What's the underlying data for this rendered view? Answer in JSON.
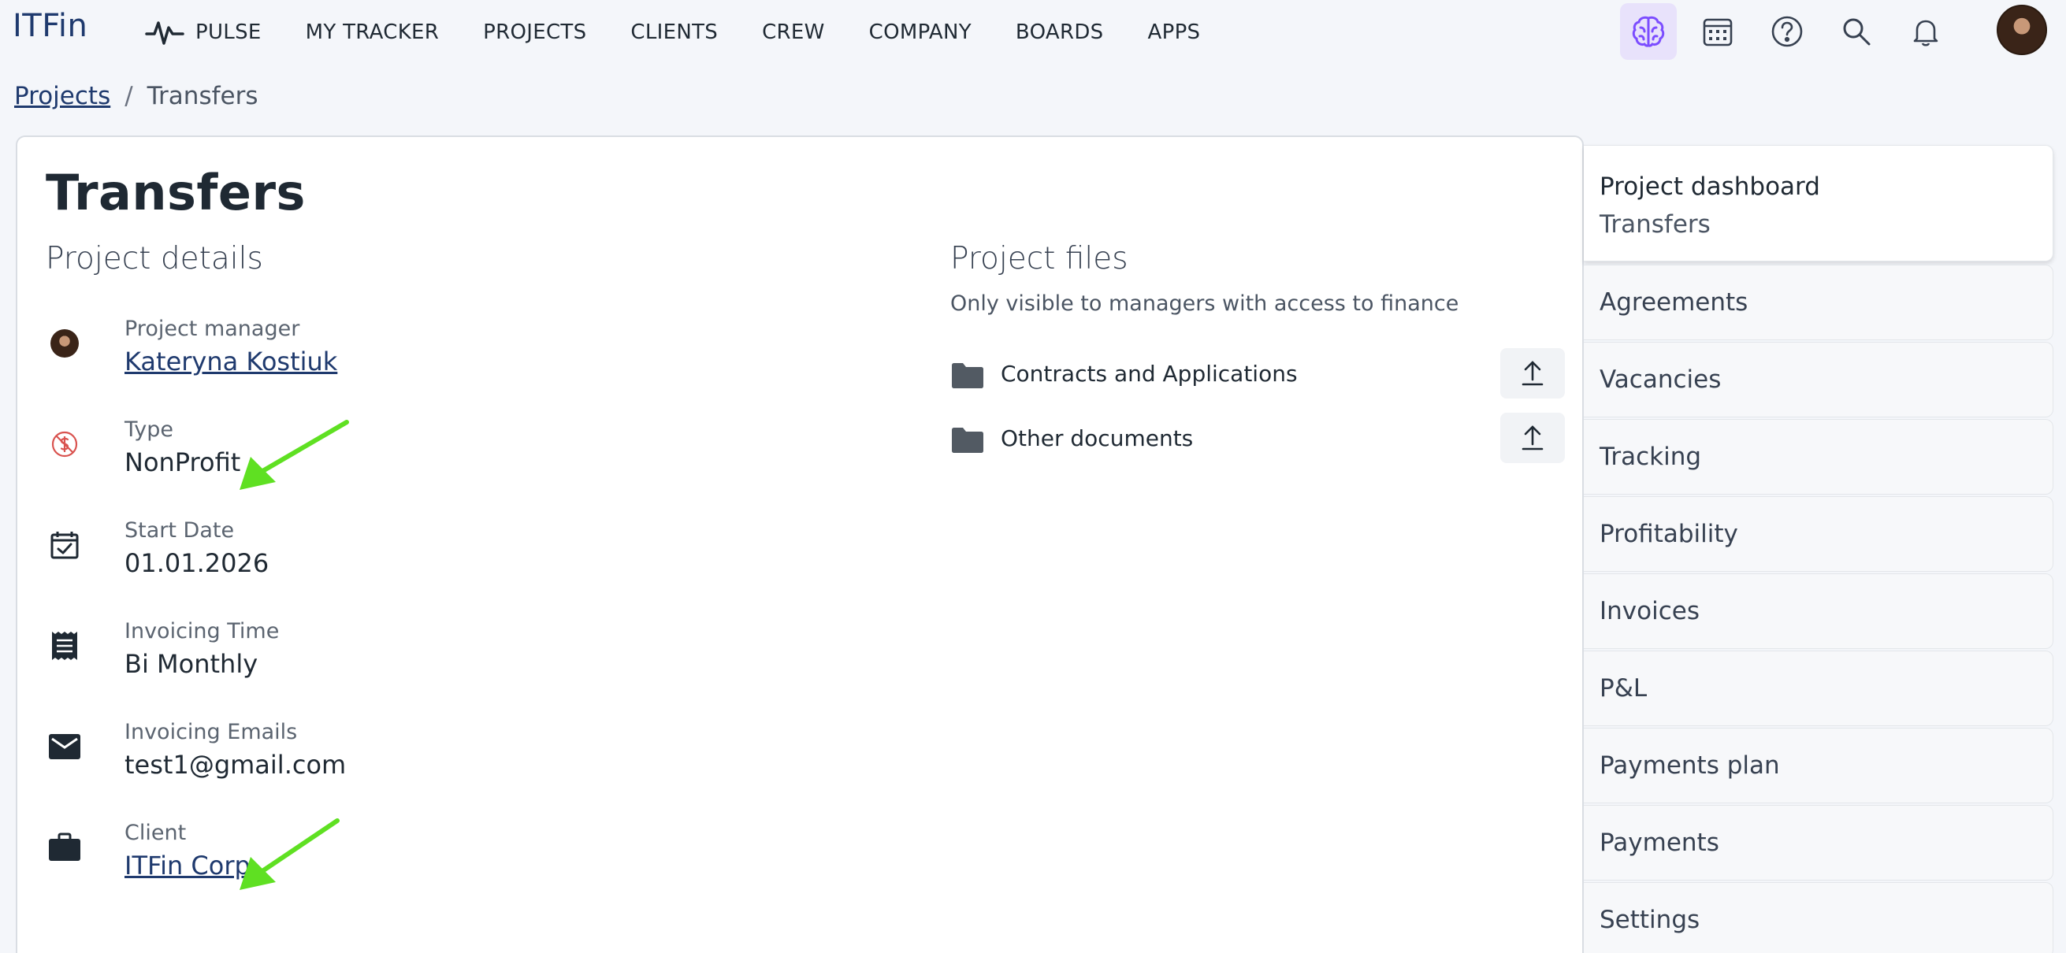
{
  "app": {
    "logo": "ITFin"
  },
  "nav": {
    "items": [
      {
        "label": "PULSE",
        "icon": "pulse-icon"
      },
      {
        "label": "MY TRACKER"
      },
      {
        "label": "PROJECTS"
      },
      {
        "label": "CLIENTS"
      },
      {
        "label": "CREW"
      },
      {
        "label": "COMPANY"
      },
      {
        "label": "BOARDS"
      },
      {
        "label": "APPS"
      }
    ],
    "icons": [
      "brain-icon",
      "calendar-icon",
      "help-icon",
      "search-icon",
      "bell-icon"
    ],
    "active_icon_color": "#7c4dff"
  },
  "breadcrumb": {
    "parent": "Projects",
    "separator": "/",
    "current": "Transfers"
  },
  "page": {
    "title": "Transfers",
    "details": {
      "heading": "Project details",
      "project_manager": {
        "label": "Project manager",
        "value": "Kateryna Kostiuk"
      },
      "type": {
        "label": "Type",
        "value": "NonProfit"
      },
      "start_date": {
        "label": "Start Date",
        "value": "01.01.2026"
      },
      "invoicing_time": {
        "label": "Invoicing Time",
        "value": "Bi Monthly"
      },
      "invoicing_emails": {
        "label": "Invoicing Emails",
        "value": "test1@gmail.com"
      },
      "client": {
        "label": "Client",
        "value": "ITFin Corp."
      }
    },
    "files": {
      "heading": "Project files",
      "subtitle": "Only visible to managers with access to finance",
      "folders": [
        {
          "name": "Contracts and Applications"
        },
        {
          "name": "Other documents"
        }
      ]
    }
  },
  "sidebar": {
    "active": {
      "title": "Project dashboard",
      "subtitle": "Transfers"
    },
    "items": [
      {
        "label": "Agreements"
      },
      {
        "label": "Vacancies"
      },
      {
        "label": "Tracking"
      },
      {
        "label": "Profitability"
      },
      {
        "label": "Invoices"
      },
      {
        "label": "P&L"
      },
      {
        "label": "Payments plan"
      },
      {
        "label": "Payments"
      },
      {
        "label": "Settings"
      }
    ]
  },
  "colors": {
    "link": "#1f3a6e",
    "annotation_arrow": "#5fe022",
    "nonprofit_icon": "#d9534f"
  }
}
